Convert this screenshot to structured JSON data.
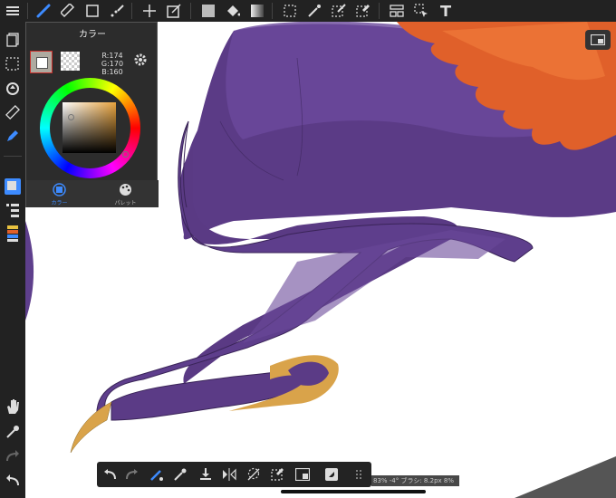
{
  "color_panel": {
    "title": "カラー",
    "rgb": {
      "r": "R:174",
      "g": "G:170",
      "b": "B:160"
    },
    "current_color": "#aeaaa0",
    "tabs": [
      {
        "label": "カラー",
        "active": true
      },
      {
        "label": "パレット",
        "active": false
      }
    ]
  },
  "status_text": "83% -4° ブラシ: 8.2px 8%",
  "colors": {
    "toolbar_bg": "#222222",
    "accent": "#3d8bff",
    "creature_purple": "#5a3a84",
    "feather_orange": "#e06a2b",
    "claw_yellow": "#d9a34a"
  },
  "icons": {
    "top_toolbar": [
      "menu-icon",
      "brush-icon",
      "eraser-icon",
      "square-icon",
      "dots-brush-icon",
      "move-icon",
      "transform-icon",
      "fill-square-icon",
      "bucket-icon",
      "gradient-icon",
      "select-rect-icon",
      "magic-wand-icon",
      "select-pen-icon",
      "select-eraser-icon",
      "layer-panel-icon",
      "select-arrow-icon",
      "text-icon"
    ],
    "left_sidebar": [
      "layers-stack-icon",
      "select-dashed-icon",
      "rotate-icon",
      "ruler-icon",
      "pen-tool-icon",
      "color-swatch-icon",
      "layer-list-icon",
      "material-icon",
      "hand-icon",
      "eyedropper-icon",
      "redo-icon",
      "undo-icon"
    ],
    "bottom_bar": [
      "undo-icon",
      "redo-icon",
      "snap-brush-icon",
      "eyedropper-icon",
      "save-download-icon",
      "flip-icon",
      "lasso-icon",
      "erase-select-icon",
      "mask-icon",
      "fullscreen-icon",
      "grid-icon"
    ]
  }
}
